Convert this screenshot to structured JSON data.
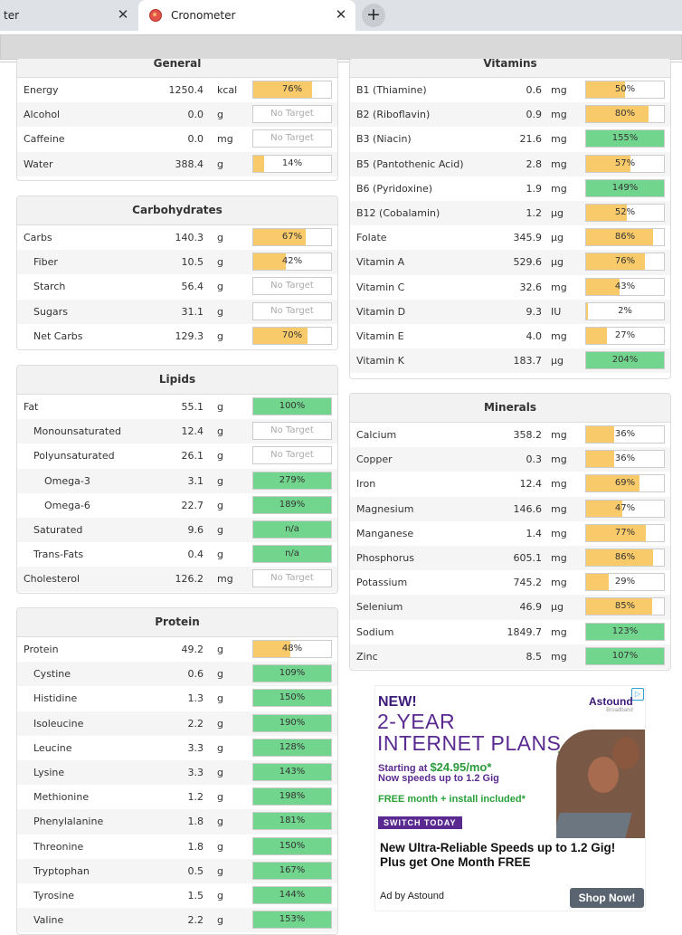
{
  "browser": {
    "tab1_title": "ter",
    "tab2_title": "Cronometer",
    "close_glyph": "✕",
    "new_tab_glyph": "+"
  },
  "colors": {
    "below": "#f8ca6a",
    "met": "#72d58e",
    "empty": "#ffffff"
  },
  "general": {
    "title": "General",
    "rows": [
      {
        "name": "Energy",
        "value": "1250.4",
        "unit": "kcal",
        "pct": "76%",
        "fill": 0.76,
        "status": "below"
      },
      {
        "name": "Alcohol",
        "value": "0.0",
        "unit": "g",
        "pct": "No Target",
        "fill": 0,
        "status": "none"
      },
      {
        "name": "Caffeine",
        "value": "0.0",
        "unit": "mg",
        "pct": "No Target",
        "fill": 0,
        "status": "none"
      },
      {
        "name": "Water",
        "value": "388.4",
        "unit": "g",
        "pct": "14%",
        "fill": 0.14,
        "status": "below"
      }
    ]
  },
  "carbohydrates": {
    "title": "Carbohydrates",
    "rows": [
      {
        "name": "Carbs",
        "value": "140.3",
        "unit": "g",
        "pct": "67%",
        "fill": 0.67,
        "status": "below",
        "level": 0
      },
      {
        "name": "Fiber",
        "value": "10.5",
        "unit": "g",
        "pct": "42%",
        "fill": 0.42,
        "status": "below",
        "level": 1
      },
      {
        "name": "Starch",
        "value": "56.4",
        "unit": "g",
        "pct": "No Target",
        "fill": 0,
        "status": "none",
        "level": 1
      },
      {
        "name": "Sugars",
        "value": "31.1",
        "unit": "g",
        "pct": "No Target",
        "fill": 0,
        "status": "none",
        "level": 1
      },
      {
        "name": "Net Carbs",
        "value": "129.3",
        "unit": "g",
        "pct": "70%",
        "fill": 0.7,
        "status": "below",
        "level": 1
      }
    ]
  },
  "lipids": {
    "title": "Lipids",
    "rows": [
      {
        "name": "Fat",
        "value": "55.1",
        "unit": "g",
        "pct": "100%",
        "fill": 1,
        "status": "met",
        "level": 0
      },
      {
        "name": "Monounsaturated",
        "value": "12.4",
        "unit": "g",
        "pct": "No Target",
        "fill": 0,
        "status": "none",
        "level": 1
      },
      {
        "name": "Polyunsaturated",
        "value": "26.1",
        "unit": "g",
        "pct": "No Target",
        "fill": 0,
        "status": "none",
        "level": 1
      },
      {
        "name": "Omega-3",
        "value": "3.1",
        "unit": "g",
        "pct": "279%",
        "fill": 1,
        "status": "met",
        "level": 2
      },
      {
        "name": "Omega-6",
        "value": "22.7",
        "unit": "g",
        "pct": "189%",
        "fill": 1,
        "status": "met",
        "level": 2
      },
      {
        "name": "Saturated",
        "value": "9.6",
        "unit": "g",
        "pct": "n/a",
        "fill": 1,
        "status": "met",
        "level": 1
      },
      {
        "name": "Trans-Fats",
        "value": "0.4",
        "unit": "g",
        "pct": "n/a",
        "fill": 1,
        "status": "met",
        "level": 1
      },
      {
        "name": "Cholesterol",
        "value": "126.2",
        "unit": "mg",
        "pct": "No Target",
        "fill": 0,
        "status": "none",
        "level": 0
      }
    ]
  },
  "protein": {
    "title": "Protein",
    "rows": [
      {
        "name": "Protein",
        "value": "49.2",
        "unit": "g",
        "pct": "48%",
        "fill": 0.48,
        "status": "below",
        "level": 0
      },
      {
        "name": "Cystine",
        "value": "0.6",
        "unit": "g",
        "pct": "109%",
        "fill": 1,
        "status": "met",
        "level": 1
      },
      {
        "name": "Histidine",
        "value": "1.3",
        "unit": "g",
        "pct": "150%",
        "fill": 1,
        "status": "met",
        "level": 1
      },
      {
        "name": "Isoleucine",
        "value": "2.2",
        "unit": "g",
        "pct": "190%",
        "fill": 1,
        "status": "met",
        "level": 1
      },
      {
        "name": "Leucine",
        "value": "3.3",
        "unit": "g",
        "pct": "128%",
        "fill": 1,
        "status": "met",
        "level": 1
      },
      {
        "name": "Lysine",
        "value": "3.3",
        "unit": "g",
        "pct": "143%",
        "fill": 1,
        "status": "met",
        "level": 1
      },
      {
        "name": "Methionine",
        "value": "1.2",
        "unit": "g",
        "pct": "198%",
        "fill": 1,
        "status": "met",
        "level": 1
      },
      {
        "name": "Phenylalanine",
        "value": "1.8",
        "unit": "g",
        "pct": "181%",
        "fill": 1,
        "status": "met",
        "level": 1
      },
      {
        "name": "Threonine",
        "value": "1.8",
        "unit": "g",
        "pct": "150%",
        "fill": 1,
        "status": "met",
        "level": 1
      },
      {
        "name": "Tryptophan",
        "value": "0.5",
        "unit": "g",
        "pct": "167%",
        "fill": 1,
        "status": "met",
        "level": 1
      },
      {
        "name": "Tyrosine",
        "value": "1.5",
        "unit": "g",
        "pct": "144%",
        "fill": 1,
        "status": "met",
        "level": 1
      },
      {
        "name": "Valine",
        "value": "2.2",
        "unit": "g",
        "pct": "153%",
        "fill": 1,
        "status": "met",
        "level": 1
      }
    ]
  },
  "vitamins": {
    "title": "Vitamins",
    "rows": [
      {
        "name": "B1 (Thiamine)",
        "value": "0.6",
        "unit": "mg",
        "pct": "50%",
        "fill": 0.5,
        "status": "below"
      },
      {
        "name": "B2 (Riboflavin)",
        "value": "0.9",
        "unit": "mg",
        "pct": "80%",
        "fill": 0.8,
        "status": "below"
      },
      {
        "name": "B3 (Niacin)",
        "value": "21.6",
        "unit": "mg",
        "pct": "155%",
        "fill": 1,
        "status": "met"
      },
      {
        "name": "B5 (Pantothenic Acid)",
        "value": "2.8",
        "unit": "mg",
        "pct": "57%",
        "fill": 0.57,
        "status": "below"
      },
      {
        "name": "B6 (Pyridoxine)",
        "value": "1.9",
        "unit": "mg",
        "pct": "149%",
        "fill": 1,
        "status": "met"
      },
      {
        "name": "B12 (Cobalamin)",
        "value": "1.2",
        "unit": "µg",
        "pct": "52%",
        "fill": 0.52,
        "status": "below"
      },
      {
        "name": "Folate",
        "value": "345.9",
        "unit": "µg",
        "pct": "86%",
        "fill": 0.86,
        "status": "below"
      },
      {
        "name": "Vitamin A",
        "value": "529.6",
        "unit": "µg",
        "pct": "76%",
        "fill": 0.76,
        "status": "below"
      },
      {
        "name": "Vitamin C",
        "value": "32.6",
        "unit": "mg",
        "pct": "43%",
        "fill": 0.43,
        "status": "below"
      },
      {
        "name": "Vitamin D",
        "value": "9.3",
        "unit": "IU",
        "pct": "2%",
        "fill": 0.02,
        "status": "below"
      },
      {
        "name": "Vitamin E",
        "value": "4.0",
        "unit": "mg",
        "pct": "27%",
        "fill": 0.27,
        "status": "below"
      },
      {
        "name": "Vitamin K",
        "value": "183.7",
        "unit": "µg",
        "pct": "204%",
        "fill": 1,
        "status": "met"
      }
    ]
  },
  "minerals": {
    "title": "Minerals",
    "rows": [
      {
        "name": "Calcium",
        "value": "358.2",
        "unit": "mg",
        "pct": "36%",
        "fill": 0.36,
        "status": "below"
      },
      {
        "name": "Copper",
        "value": "0.3",
        "unit": "mg",
        "pct": "36%",
        "fill": 0.36,
        "status": "below"
      },
      {
        "name": "Iron",
        "value": "12.4",
        "unit": "mg",
        "pct": "69%",
        "fill": 0.69,
        "status": "below"
      },
      {
        "name": "Magnesium",
        "value": "146.6",
        "unit": "mg",
        "pct": "47%",
        "fill": 0.47,
        "status": "below"
      },
      {
        "name": "Manganese",
        "value": "1.4",
        "unit": "mg",
        "pct": "77%",
        "fill": 0.77,
        "status": "below"
      },
      {
        "name": "Phosphorus",
        "value": "605.1",
        "unit": "mg",
        "pct": "86%",
        "fill": 0.86,
        "status": "below"
      },
      {
        "name": "Potassium",
        "value": "745.2",
        "unit": "mg",
        "pct": "29%",
        "fill": 0.29,
        "status": "below"
      },
      {
        "name": "Selenium",
        "value": "46.9",
        "unit": "µg",
        "pct": "85%",
        "fill": 0.85,
        "status": "below"
      },
      {
        "name": "Sodium",
        "value": "1849.7",
        "unit": "mg",
        "pct": "123%",
        "fill": 1,
        "status": "met"
      },
      {
        "name": "Zinc",
        "value": "8.5",
        "unit": "mg",
        "pct": "107%",
        "fill": 1,
        "status": "met"
      }
    ]
  },
  "ad": {
    "new": "NEW!",
    "headline_1": "2-YEAR",
    "headline_2": "INTERNET PLANS",
    "starting_prefix": "Starting at ",
    "price": "$24.95/mo*",
    "speeds": "Now speeds up to 1.2 Gig",
    "free": "FREE month + install included*",
    "switch": "SWITCH TODAY",
    "brand": "Astound",
    "tagline": "New Ultra-Reliable Speeds up to 1.2 Gig! Plus get One Month FREE",
    "by": "Ad by Astound",
    "cta": "Shop Now!"
  }
}
